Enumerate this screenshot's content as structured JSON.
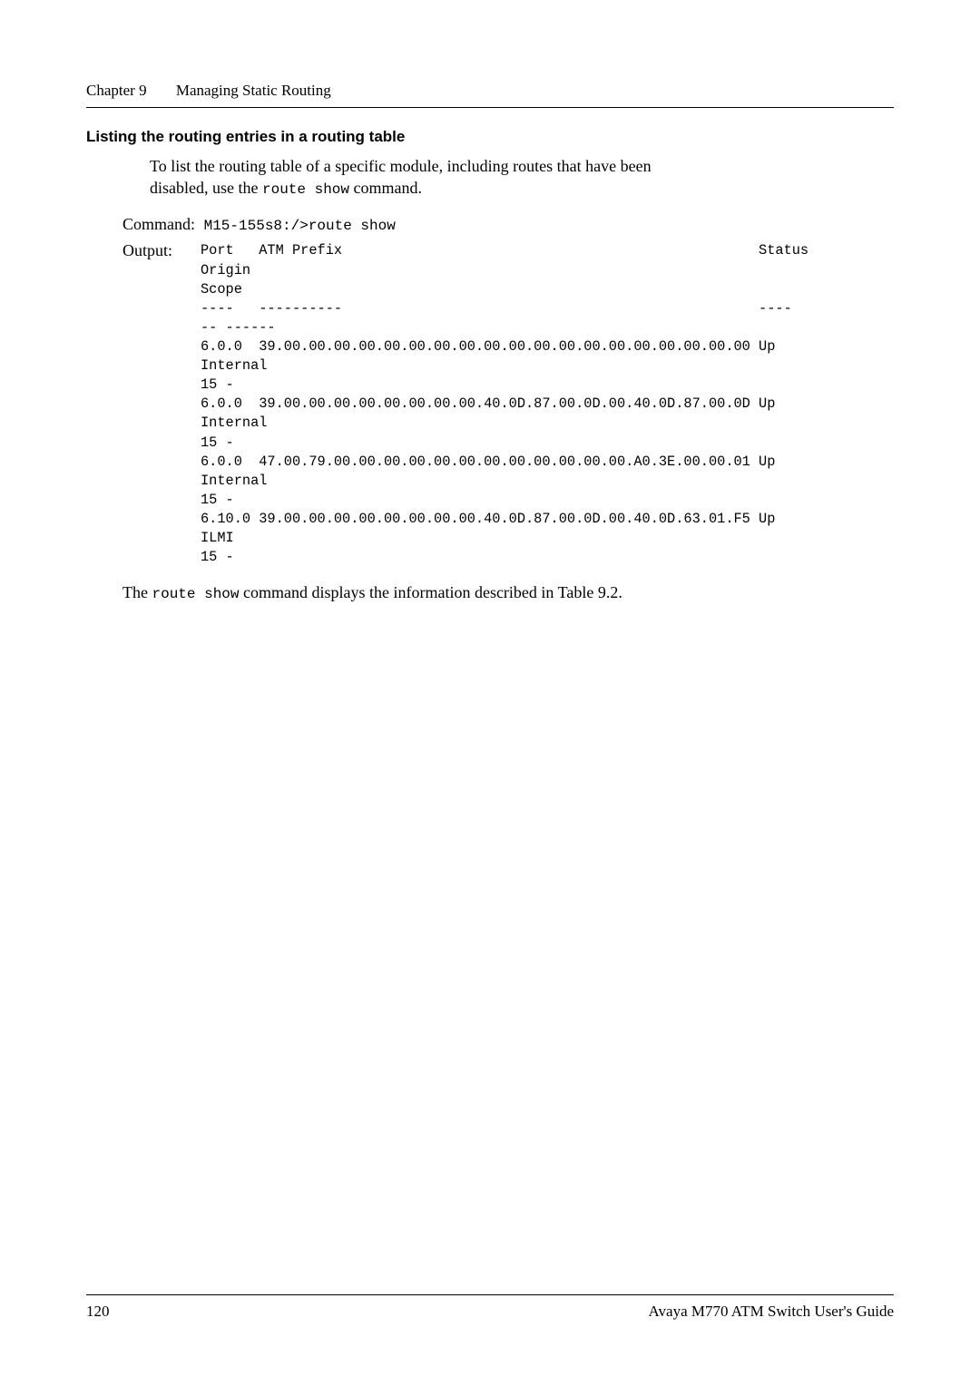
{
  "header": {
    "chapter_label": "Chapter 9",
    "chapter_title": "Managing Static Routing"
  },
  "section": {
    "title": "Listing the routing entries in a routing table",
    "intro_line1": "To list the routing table of a specific module, including routes that have been",
    "intro_line2": "disabled, use the ",
    "intro_cmd": "route show",
    "intro_line2_tail": " command."
  },
  "command": {
    "label": "Command:",
    "text": " M15-155s8:/>route show"
  },
  "output": {
    "label": "Output:",
    "block": "Port   ATM Prefix                                                  Status   \nOrigin   \nScope\n----   ----------                                                  ----\n-- ------\n6.0.0  39.00.00.00.00.00.00.00.00.00.00.00.00.00.00.00.00.00.00.00 Up    \nInternal \n15 -\n6.0.0  39.00.00.00.00.00.00.00.00.40.0D.87.00.0D.00.40.0D.87.00.0D Up    \nInternal \n15 -\n6.0.0  47.00.79.00.00.00.00.00.00.00.00.00.00.00.00.A0.3E.00.00.01 Up    \nInternal \n15 -\n6.10.0 39.00.00.00.00.00.00.00.00.40.0D.87.00.0D.00.40.0D.63.01.F5 Up    \nILMI     \n15 -"
  },
  "closing": {
    "pre": "The ",
    "cmd": "route show",
    "post": " command displays the information described in Table 9.2."
  },
  "footer": {
    "page_number": "120",
    "guide_title": "Avaya M770 ATM Switch User's Guide"
  }
}
